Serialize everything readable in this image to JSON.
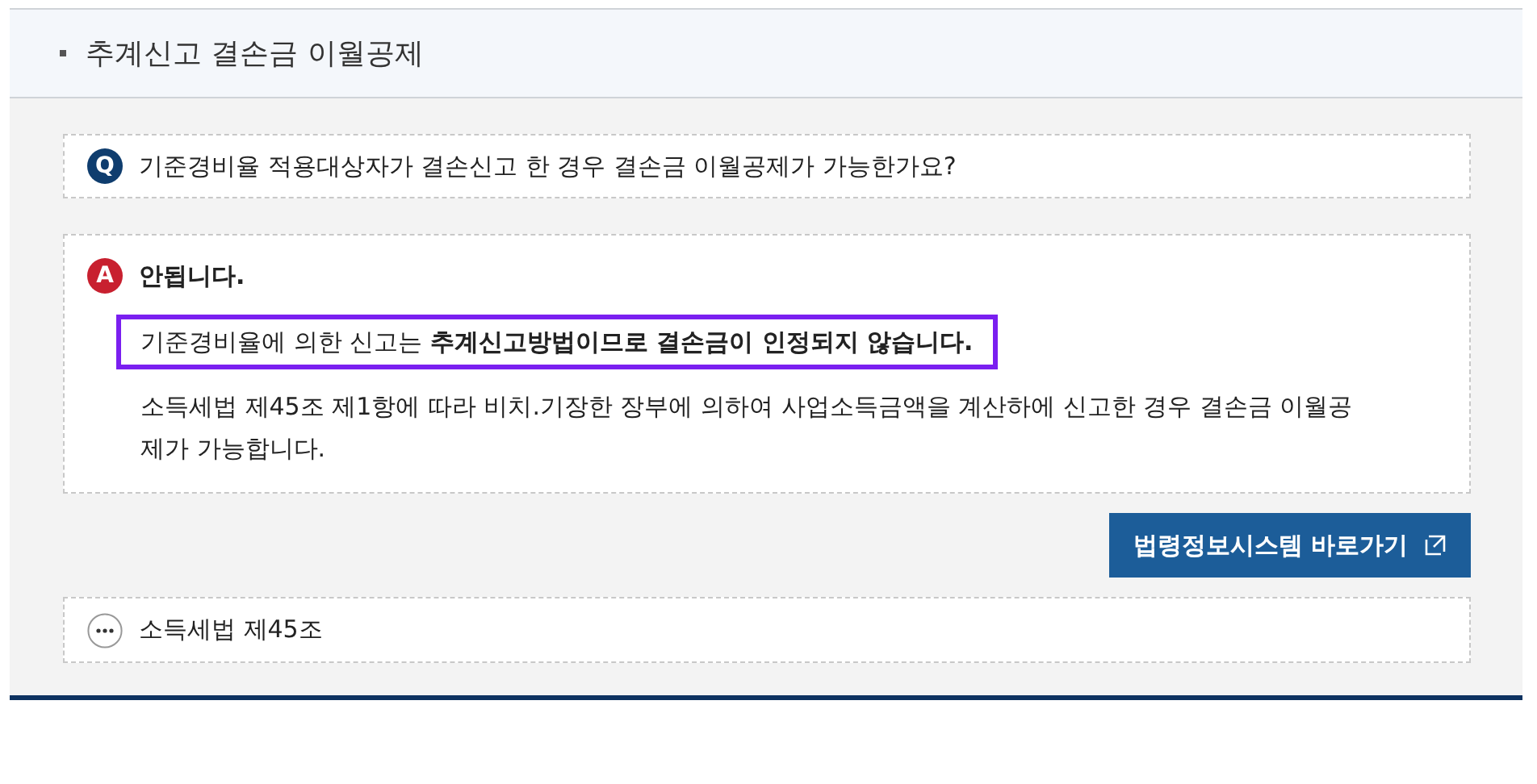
{
  "section": {
    "title": "추계신고 결손금 이월공제"
  },
  "question": {
    "badge": "Q",
    "text": "기준경비율 적용대상자가 결손신고 한 경우 결손금 이월공제가 가능한가요?"
  },
  "answer": {
    "badge": "A",
    "title": "안됩니다.",
    "paragraphs": [
      {
        "text": "기준경비율에 의한 신고는 **추계신고방법이므로 결손금이 인정되지 않습니다.**",
        "highlighted": true
      },
      {
        "text": "소득세법 제45조 제1항에 따라 비치.기장한 장부에 의하여 사업소득금액을 계산하에 신고한 경우 결손금 이월공제가 가능합니다.",
        "highlighted": false
      }
    ]
  },
  "link_button": {
    "label": "법령정보시스템 바로가기"
  },
  "reference": {
    "text": "소득세법 제45조",
    "expanded": false
  }
}
